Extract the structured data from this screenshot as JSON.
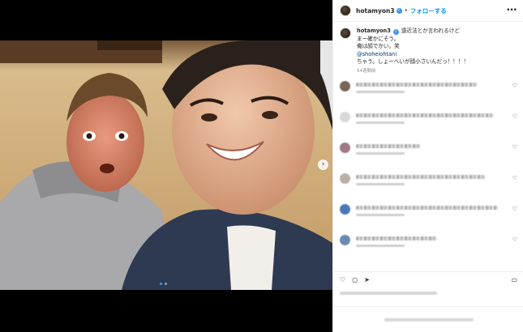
{
  "post": {
    "username": "hotamyon3",
    "follow_label": "フォローする",
    "separator": "•",
    "more_label": "•••"
  },
  "caption": {
    "username": "hotamyon3",
    "line1": "遠近法とか言われるけど",
    "line2": "まー確かにそう。",
    "line3": "俺は顔でかい。笑",
    "mention": "@shoheiohtani",
    "line5": "ちゃう。しょーへいが顔小さいんだっ！！！！",
    "time": "54週間前"
  },
  "icons": {
    "verified": "verified-badge-icon",
    "heart": "heart-icon",
    "comment": "comment-icon",
    "share": "share-icon",
    "bookmark": "bookmark-icon",
    "next": "chevron-right-icon"
  },
  "glyphs": {
    "verified": "✓",
    "heart": "♡",
    "comment": "○",
    "share": "➤",
    "bookmark": "▭",
    "next": "›"
  },
  "colors": {
    "link": "#0095f6",
    "verified": "#3897f0",
    "text": "#262626",
    "muted": "#8e8e8e"
  },
  "carousel": {
    "slides": 2,
    "active": 1
  }
}
